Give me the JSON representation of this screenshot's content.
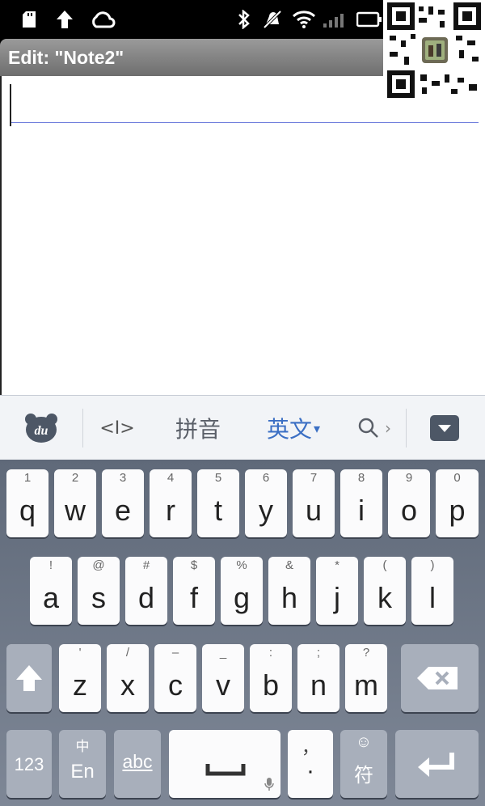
{
  "window": {
    "title": "Edit: \"Note2\""
  },
  "editor": {
    "value": ""
  },
  "ime": {
    "cursor_label": "<I>",
    "pinyin_label": "拼音",
    "english_label": "英文",
    "english_arrow": "▾",
    "more_label": "›"
  },
  "keyboard": {
    "row1": [
      {
        "sym": "1",
        "main": "q"
      },
      {
        "sym": "2",
        "main": "w"
      },
      {
        "sym": "3",
        "main": "e"
      },
      {
        "sym": "4",
        "main": "r"
      },
      {
        "sym": "5",
        "main": "t"
      },
      {
        "sym": "6",
        "main": "y"
      },
      {
        "sym": "7",
        "main": "u"
      },
      {
        "sym": "8",
        "main": "i"
      },
      {
        "sym": "9",
        "main": "o"
      },
      {
        "sym": "0",
        "main": "p"
      }
    ],
    "row2": [
      {
        "sym": "!",
        "main": "a"
      },
      {
        "sym": "@",
        "main": "s"
      },
      {
        "sym": "#",
        "main": "d"
      },
      {
        "sym": "$",
        "main": "f"
      },
      {
        "sym": "%",
        "main": "g"
      },
      {
        "sym": "&",
        "main": "h"
      },
      {
        "sym": "*",
        "main": "j"
      },
      {
        "sym": "(",
        "main": "k"
      },
      {
        "sym": ")",
        "main": "l"
      }
    ],
    "row3": [
      {
        "sym": "'",
        "main": "z"
      },
      {
        "sym": "/",
        "main": "x"
      },
      {
        "sym": "–",
        "main": "c"
      },
      {
        "sym": "_",
        "main": "v"
      },
      {
        "sym": ":",
        "main": "b"
      },
      {
        "sym": ";",
        "main": "n"
      },
      {
        "sym": "?",
        "main": "m"
      }
    ],
    "num_label": "123",
    "lang_top": "中",
    "lang_bottom": "En",
    "abc_label": "abc",
    "comma_label": "，",
    "period_label": "·",
    "emoji_top": "☺",
    "emoji_bottom": "符"
  }
}
